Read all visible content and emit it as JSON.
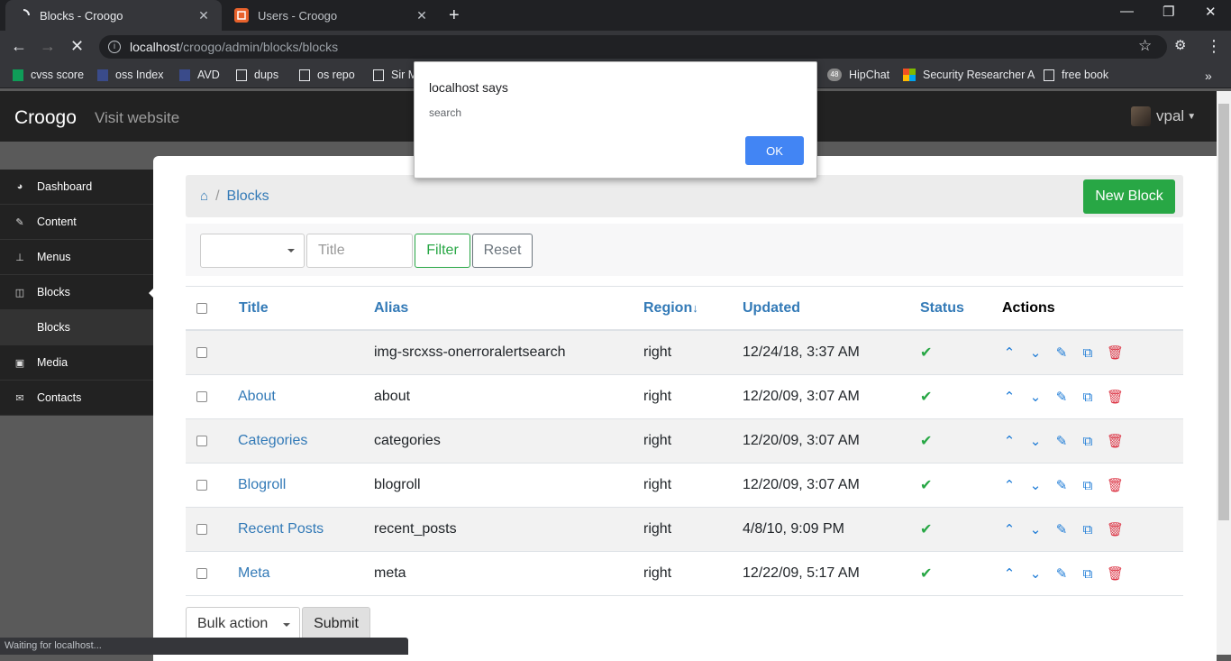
{
  "browser": {
    "tabs": [
      {
        "title": "Blocks - Croogo"
      },
      {
        "title": "Users - Croogo"
      }
    ],
    "url_host": "localhost",
    "url_path": "/croogo/admin/blocks/blocks",
    "bookmarks": [
      "cvss score",
      "oss Index",
      "AVD",
      "dups",
      "os repo",
      "Sir M",
      "HipChat",
      "Security Researcher A",
      "free book"
    ],
    "hipchat_badge": "48",
    "status_text": "Waiting for localhost..."
  },
  "app": {
    "brand": "Croogo",
    "visit_website": "Visit website",
    "user": "vpal"
  },
  "sidebar": {
    "items": [
      {
        "label": "Dashboard",
        "icon": "dashboard-icon"
      },
      {
        "label": "Content",
        "icon": "edit-icon"
      },
      {
        "label": "Menus",
        "icon": "sitemap-icon"
      },
      {
        "label": "Blocks",
        "icon": "columns-icon"
      },
      {
        "label": "Blocks",
        "icon": ""
      },
      {
        "label": "Media",
        "icon": "image-icon"
      },
      {
        "label": "Contacts",
        "icon": "comments-icon"
      }
    ]
  },
  "breadcrumb": {
    "current": "Blocks"
  },
  "new_block_label": "New Block",
  "filter": {
    "title_placeholder": "Title",
    "filter_label": "Filter",
    "reset_label": "Reset"
  },
  "table": {
    "headers": {
      "title": "Title",
      "alias": "Alias",
      "region": "Region",
      "region_sort": "↓",
      "updated": "Updated",
      "status": "Status",
      "actions": "Actions"
    },
    "rows": [
      {
        "title": "",
        "alias": "img-srcxss-onerroralertsearch",
        "region": "right",
        "updated": "12/24/18, 3:37 AM",
        "status": "✔"
      },
      {
        "title": "About",
        "alias": "about",
        "region": "right",
        "updated": "12/20/09, 3:07 AM",
        "status": "✔"
      },
      {
        "title": "Categories",
        "alias": "categories",
        "region": "right",
        "updated": "12/20/09, 3:07 AM",
        "status": "✔"
      },
      {
        "title": "Blogroll",
        "alias": "blogroll",
        "region": "right",
        "updated": "12/20/09, 3:07 AM",
        "status": "✔"
      },
      {
        "title": "Recent Posts",
        "alias": "recent_posts",
        "region": "right",
        "updated": "4/8/10, 9:09 PM",
        "status": "✔"
      },
      {
        "title": "Meta",
        "alias": "meta",
        "region": "right",
        "updated": "12/22/09, 5:17 AM",
        "status": "✔"
      }
    ]
  },
  "bulk": {
    "label": "Bulk action",
    "submit_label": "Submit"
  },
  "dialog": {
    "title": "localhost says",
    "message": "search",
    "ok_label": "OK"
  },
  "colors": {
    "accent": "#337ab7",
    "success": "#28a745",
    "danger": "#dc3545"
  }
}
